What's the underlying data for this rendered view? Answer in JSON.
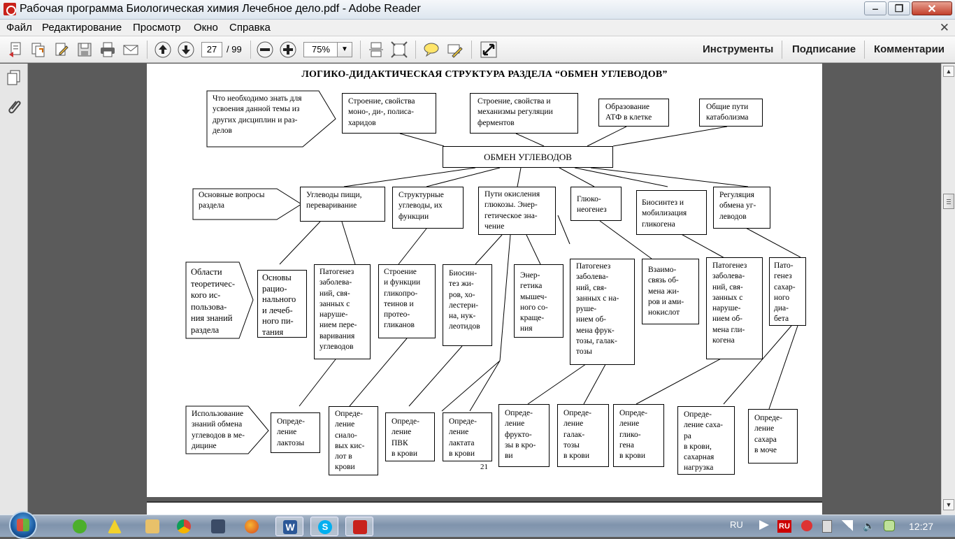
{
  "window": {
    "title": "Рабочая программа Биологическая химия Лечебное дело.pdf - Adobe Reader"
  },
  "menu": [
    "Файл",
    "Редактирование",
    "Просмотр",
    "Окно",
    "Справка"
  ],
  "toolbar": {
    "page_current": "27",
    "page_total": "/ 99",
    "zoom": "75%",
    "tools": "Инструменты",
    "sign": "Подписание",
    "comments": "Комментарии"
  },
  "document": {
    "heading": "ЛОГИКО-ДИДАКТИЧЕСКАЯ СТРУКТУРА РАЗДЕЛА “ОБМЕН УГЛЕВОДОВ”",
    "page_number": "21",
    "arrows": {
      "prerequisites": "Что необходимо знать для\nусвоения данной темы из\nдругих дисциплин и раз-\nделов",
      "main_questions": "Основные вопросы\nраздела",
      "theory_areas": "Области\nтеоретичес-\nкого      ис-\nпользова-\nния  знаний\nраздела",
      "medicine_use": "Использование\nзнаний  обмена\nуглеводов в ме-\nдицине"
    },
    "top_boxes": [
      "Строение, свойства\nмоно-, ди-, полиса-\nхаридов",
      "Строение, свойства и\nмеханизмы регуляции\nферментов",
      "Образование\nАТФ в клетке",
      "Общие    пути\nкатаболизма"
    ],
    "center": "ОБМЕН УГЛЕВОДОВ",
    "row2": [
      "Углеводы пищи,\nпереваривание",
      "Структурные\nуглеводы, их\nфункции",
      "Пути окисления\nглюкозы. Энер-\nгетическое зна-\nчение",
      "Глюко-\nнеогенез",
      "Биосинтез и\nмобилизация\nгликогена",
      "Регуляция\nобмена уг-\nлеводов"
    ],
    "row3": [
      "Основы\nрацио-\nнального\nи лечеб-\nного пи-\nтания",
      "Патогенез\nзаболева-\nний, свя-\nзанных с\nнаруше-\nнием пере-\nваривания\nуглеводов",
      "Строение\nи функции\nгликопро-\nтеинов и\nпротео-\nгликанов",
      "Биосин-\nтез жи-\nров, хо-\nлестери-\nна, нук-\nлеотидов",
      "Энер-\nгетика\nмышеч-\nного со-\nкраще-\nния",
      "Патогенез\nзаболева-\nний, свя-\nзанных с на-\nруше-\nнием об-\nмена фрук-\nтозы, галак-\nтозы",
      "Взаимо-\nсвязь об-\nмена жи-\nров и ами-\nнокислот",
      "Патогенез\nзаболева-\nний, свя-\nзанных с\nнаруше-\nнием об-\nмена гли-\nкогена",
      "Пато-\nгенез\nсахар-\nного\nдиа-\nбета"
    ],
    "row4": [
      "Опреде-\nление\nлактозы",
      "Опреде-\nление\nсиало-\nвых кис-\nлот в\nкрови",
      "Опреде-\nление\nПВК\nв крови",
      "Опреде-\nление\nлактата\nв крови",
      "Опреде-\nление\nфрукто-\nзы в кро-\nви",
      "Опреде-\nление\nгалак-\nтозы\nв крови",
      "Опреде-\nление\nглико-\nгена\nв крови",
      "Опреде-\nление  саха-\nра\nв крови,\nсахарная\nнагрузка",
      "Опреде-\nление\nсахара\nв моче"
    ]
  },
  "taskbar": {
    "lang": "RU",
    "clock": "12:27"
  },
  "colors": {
    "titlebar": "#dde6ef",
    "close_button": "#c2402c",
    "doc_background": "#5b5b5b",
    "taskbar": "#8a9db4"
  }
}
